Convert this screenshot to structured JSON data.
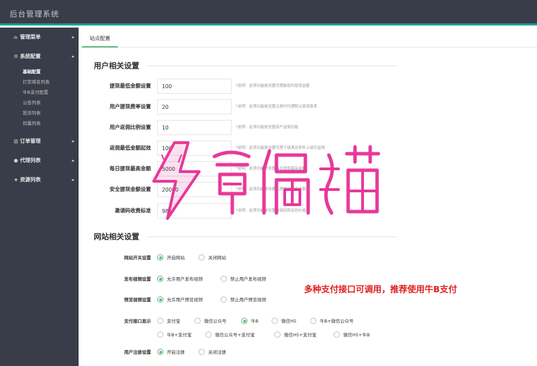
{
  "header": {
    "title": "后台管理系统"
  },
  "sidebar": {
    "menus": [
      {
        "label": "管理菜单",
        "icon": "home-icon"
      },
      {
        "label": "系统配置",
        "icon": "gears-icon",
        "children": [
          "基础配置",
          "打赏域名列表",
          "牛B支付配置",
          "公告列表",
          "投诉列表",
          "扣量列表"
        ]
      },
      {
        "label": "订单管理",
        "icon": "bar-chart-icon"
      },
      {
        "label": "代理列表",
        "icon": "user-icon"
      },
      {
        "label": "资源列表",
        "icon": "star-icon"
      }
    ]
  },
  "tabs": [
    {
      "label": "站点配置"
    }
  ],
  "user_section": {
    "title": "用户相关设置",
    "fields": [
      {
        "label": "提现最低金额设置",
        "value": "100",
        "hint": "*说明：此项功能是设置代理最低的提现金额"
      },
      {
        "label": "用户提现费率设置",
        "value": "20",
        "hint": "*说明：此项功能是设置注册时代理默认提现费率"
      },
      {
        "label": "用户返佣比例设置",
        "value": "10",
        "hint": "*说明：此项功能是设置用户返佣功能"
      },
      {
        "label": "返佣最低金额起效",
        "value": "100",
        "hint": "*说明：此项功能是设置代理下级满足条件上级可返佣"
      },
      {
        "label": "每日提现最高金额",
        "value": "5000",
        "hint": "*说明：此项功能是设置每日提现最高金额"
      },
      {
        "label": "安全提现金额设置",
        "value": "20000",
        "hint": "*说明：此项功能是设置代理提现安全金额"
      },
      {
        "label": "邀请码收费标准",
        "value": "98",
        "hint": "*说明：此项功能是设置邀请码购买的价格"
      }
    ]
  },
  "site_section": {
    "title": "网站相关设置",
    "site_switch": {
      "label": "网站开关设置",
      "options": [
        "开启网站",
        "关闭网站"
      ],
      "selected": 0
    },
    "publish_video": {
      "label": "发布视频设置",
      "options": [
        "允许用户发布视频",
        "禁止用户发布视频"
      ],
      "selected": 0
    },
    "preview_video": {
      "label": "预览视频设置",
      "options": [
        "允许用户预览视频",
        "禁止用户预览视频"
      ],
      "selected": 0
    },
    "payment": {
      "label": "支付接口显示",
      "options": [
        "支付宝",
        "微信公众号",
        "牛B",
        "微信H5",
        "牛B+微信公众号",
        "牛B+支付宝",
        "微信公众号+支付宝",
        "微信H5+支付宝",
        "微信H5+牛B"
      ],
      "selected": 2
    },
    "register": {
      "label": "用户注册设置",
      "options": [
        "开启注册",
        "关闭注册"
      ],
      "selected": 0
    }
  },
  "promo": {
    "text": "多种支付接口可调用，推荐使用牛B支付",
    "color": "#e02020"
  },
  "colors": {
    "sidebar_bg": "#393d49",
    "accent": "#1aa094",
    "radio_checked": "#5fb878",
    "watermark": "#e7399a"
  }
}
